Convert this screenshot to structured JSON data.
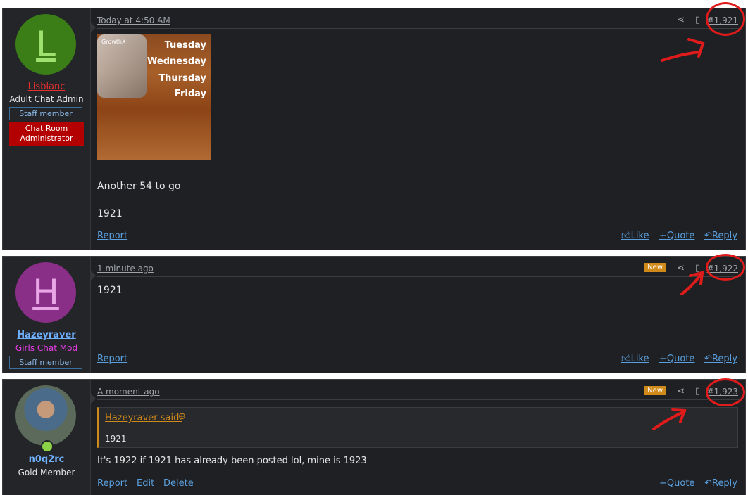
{
  "posts": [
    {
      "date": "Today at 4:50 AM",
      "number": "#1,921",
      "user": {
        "name": "Lisblanc",
        "title": "Adult Chat Admin",
        "badge": "Staff member",
        "role_badge": "Chat Room Administrator",
        "avatar_letter": "L"
      },
      "image_caption": {
        "brand": "GrowthX",
        "days": [
          "Tuesday",
          "Wednesday",
          "Thursday",
          "Friday"
        ]
      },
      "body": [
        "Another 54 to go",
        "1921"
      ],
      "actions": {
        "report": "Report",
        "like": "Like",
        "quote": "Quote",
        "reply": "Reply"
      }
    },
    {
      "date": "1 minute ago",
      "number": "#1,922",
      "new_badge": "New",
      "user": {
        "name": "Hazeyraver",
        "title": "Girls Chat Mod",
        "badge": "Staff member",
        "avatar_letter": "H"
      },
      "body": [
        "1921"
      ],
      "actions": {
        "report": "Report",
        "like": "Like",
        "quote": "Quote",
        "reply": "Reply"
      }
    },
    {
      "date": "A moment ago",
      "number": "#1,923",
      "new_badge": "New",
      "user": {
        "name": "n0q2rc",
        "title": "Gold Member"
      },
      "quote": {
        "author": "Hazeyraver said:",
        "text": "1921"
      },
      "body": [
        "It's 1922 if 1921 has already been posted lol, mine is 1923"
      ],
      "actions": {
        "report": "Report",
        "edit": "Edit",
        "delete": "Delete",
        "quote": "Quote",
        "reply": "Reply"
      }
    }
  ],
  "colors": {
    "accent_link": "#5aa0e0",
    "new_badge": "#d08a1a",
    "annotation_red": "#e01b1b",
    "admin_red": "#b30000"
  }
}
